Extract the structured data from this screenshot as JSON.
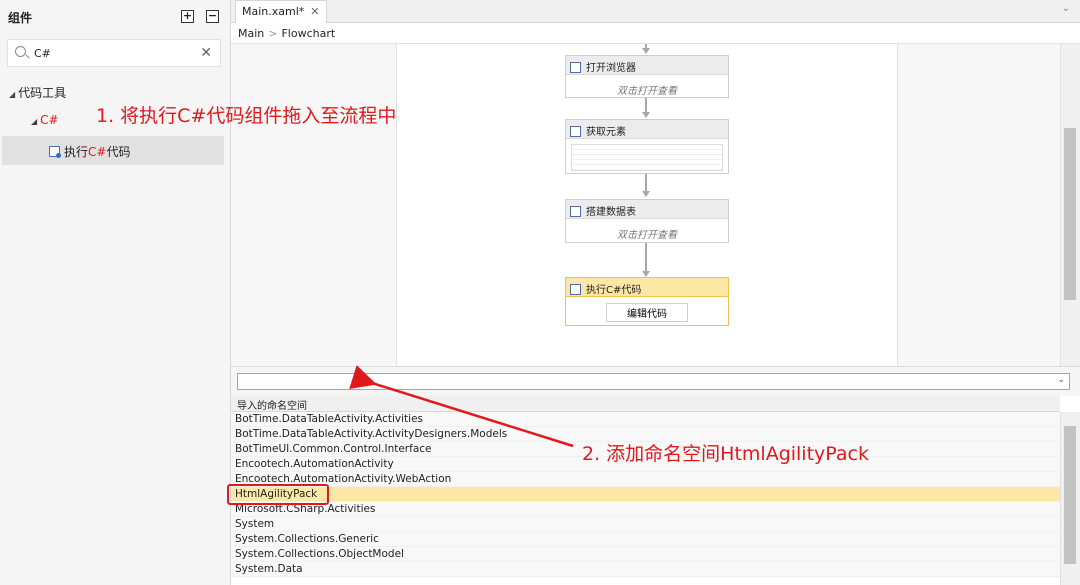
{
  "left_panel": {
    "title": "组件",
    "expand_label": "+",
    "collapse_label": "−",
    "search_value": "C#",
    "search_placeholder": "",
    "clear_label": "✕",
    "tree": {
      "category": "代码工具",
      "subcategory": "C#",
      "item_prefix": "执行",
      "item_highlight": "C#",
      "item_suffix": "代码"
    }
  },
  "tabs": [
    {
      "label": "Main.xaml*",
      "close": "✕"
    }
  ],
  "tab_dropdown": "⌄",
  "breadcrumb": {
    "root": "Main",
    "sep": ">",
    "current": "Flowchart"
  },
  "flowchart": {
    "cards": [
      {
        "title": "打开浏览器",
        "body": "双击打开查看"
      },
      {
        "title": "获取元素"
      },
      {
        "title": "搭建数据表",
        "body": "双击打开查看"
      },
      {
        "title": "执行C#代码",
        "button": "编辑代码"
      }
    ]
  },
  "namespaces": {
    "input_value": "",
    "dropdown": "⌄",
    "header": "导入的命名空间",
    "items": [
      "BotTime.DataTableActivity.Activities",
      "BotTime.DataTableActivity.ActivityDesigners.Models",
      "BotTimeUI.Common.Control.Interface",
      "Encootech.AutomationActivity",
      "Encootech.AutomationActivity.WebAction",
      "HtmlAgilityPack",
      "Microsoft.CSharp.Activities",
      "System",
      "System.Collections.Generic",
      "System.Collections.ObjectModel",
      "System.Data"
    ],
    "selected_index": 5
  },
  "annotations": {
    "step1": "1. 将执行C#代码组件拖入至流程中",
    "step2": "2. 添加命名空间HtmlAgilityPack",
    "color": "#e0191d"
  },
  "colors": {
    "accent_red": "#e0191d",
    "highlight_yellow": "#fde7a6"
  }
}
